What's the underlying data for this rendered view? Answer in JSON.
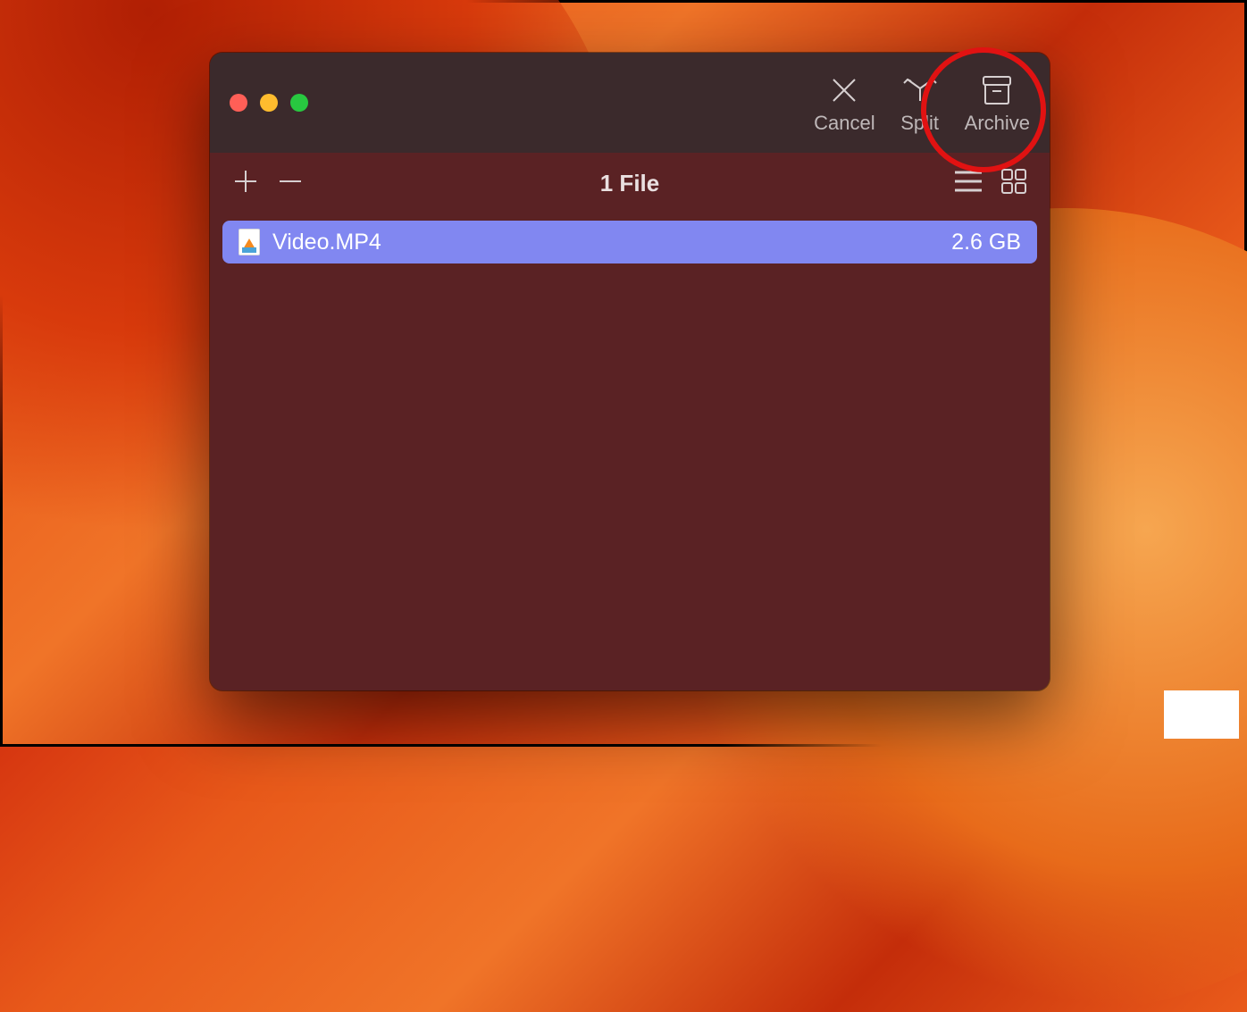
{
  "toolbar": {
    "cancel_label": "Cancel",
    "split_label": "Split",
    "archive_label": "Archive"
  },
  "subbar": {
    "file_count_label": "1 File"
  },
  "files": [
    {
      "name": "Video.MP4",
      "size": "2.6 GB"
    }
  ],
  "icons": {
    "cancel": "x-icon",
    "split": "split-arrows-icon",
    "archive": "archive-box-icon",
    "add": "plus-icon",
    "remove": "minus-icon",
    "list_view": "list-lines-icon",
    "grid_view": "grid-squares-icon"
  }
}
